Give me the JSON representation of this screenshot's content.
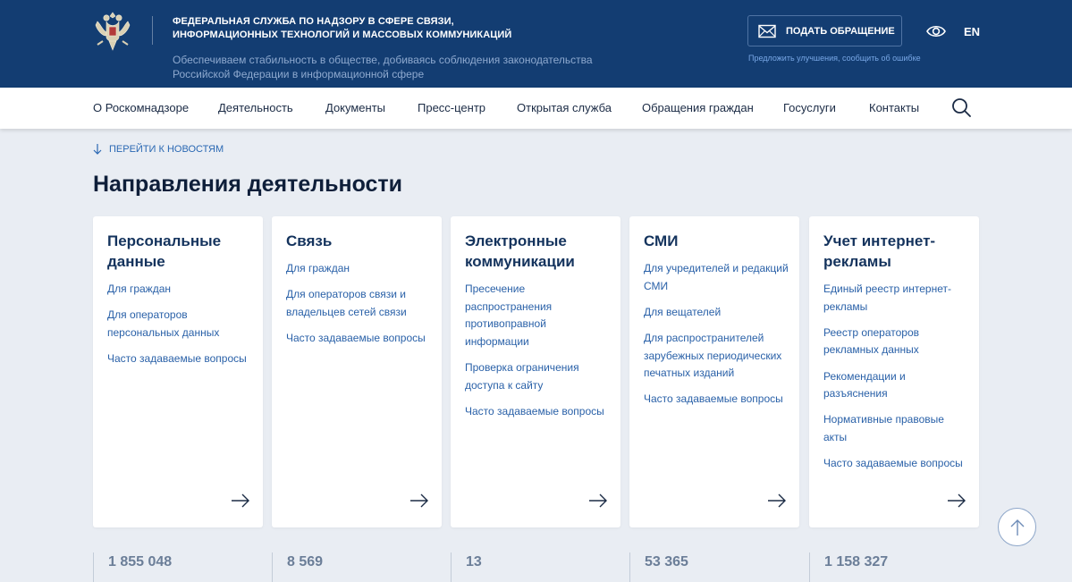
{
  "header": {
    "agency_name_line1": "ФЕДЕРАЛЬНАЯ СЛУЖБА ПО НАДЗОРУ В СФЕРЕ СВЯЗИ,",
    "agency_name_line2": "ИНФОРМАЦИОННЫХ ТЕХНОЛОГИЙ И МАССОВЫХ КОММУНИКАЦИЙ",
    "motto_line1": "Обеспечиваем стабильность в обществе, добиваясь соблюдения законодательства",
    "motto_line2": "Российской Федерации в информационной сфере",
    "appeal_button": "ПОДАТЬ ОБРАЩЕНИЕ",
    "appeal_subtext": "Предложить улучшения, сообщить об ошибке",
    "lang": "EN",
    "icons": {
      "emblem": "coat-of-arms",
      "appeal": "envelope-icon",
      "accessibility": "eye-icon"
    }
  },
  "nav": {
    "items": [
      "О Роскомнадзоре",
      "Деятельность",
      "Документы",
      "Пресс-центр",
      "Открытая служба",
      "Обращения граждан",
      "Госуслуги",
      "Контакты"
    ],
    "search_icon": "search-icon"
  },
  "main": {
    "skip_link": "ПЕРЕЙТИ К НОВОСТЯМ",
    "section_title": "Направления деятельности",
    "cards": [
      {
        "title": "Персональные данные",
        "links": [
          "Для граждан",
          "Для операторов персональных данных",
          "Часто задаваемые вопросы"
        ]
      },
      {
        "title": "Связь",
        "links": [
          "Для граждан",
          "Для операторов связи и владельцев сетей связи",
          "Часто задаваемые вопросы"
        ]
      },
      {
        "title": "Электронные коммуникации",
        "links": [
          "Пресечение распространения противоправной информации",
          "Проверка ограничения доступа к сайту",
          "Часто задаваемые вопросы"
        ]
      },
      {
        "title": "СМИ",
        "links": [
          "Для учредителей и редакций СМИ",
          "Для вещателей",
          "Для распространителей зарубежных периодических печатных изданий",
          "Часто задаваемые вопросы"
        ]
      },
      {
        "title": "Учет интернет-рекламы",
        "links": [
          "Единый реестр интернет-рекламы",
          "Реестр операторов рекламных данных",
          "Рекомендации и разъяснения",
          "Нормативные правовые акты",
          "Часто задаваемые вопросы"
        ]
      }
    ],
    "stats": [
      "1 855 048",
      "8 569",
      "13",
      "53 365",
      "1 158 327"
    ]
  },
  "colors": {
    "header_bg": "#133d72",
    "link": "#2a61a8",
    "page_bg": "#e9edf3"
  }
}
